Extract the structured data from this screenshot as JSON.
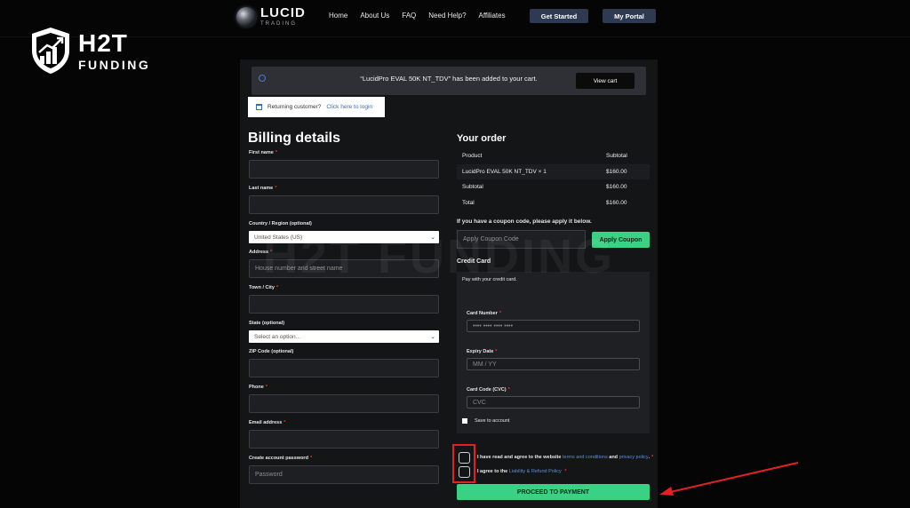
{
  "brand": {
    "main": "LUCID",
    "sub": "TRADING"
  },
  "nav": {
    "links": [
      "Home",
      "About Us",
      "FAQ",
      "Need Help?",
      "Affiliates"
    ],
    "get_started": "Get Started",
    "my_portal": "My Portal"
  },
  "h2t": {
    "main": "H2T",
    "sub": "FUNDING",
    "watermark": "H2T FUNDING"
  },
  "notice": {
    "text": "“LucidPro EVAL 50K NT_TDV” has been added to your cart.",
    "view_cart": "View cart"
  },
  "login": {
    "prefix": "Returning customer?",
    "link": "Click here to login"
  },
  "billing": {
    "title": "Billing details",
    "first_name": "First name",
    "last_name": "Last name",
    "country_label": "Country / Region (optional)",
    "country_value": "United States (US)",
    "address_label": "Address",
    "address_placeholder": "House number and street name",
    "city_label": "Town / City",
    "state_label": "State (optional)",
    "state_placeholder": "Select an option...",
    "zip_label": "ZIP Code (optional)",
    "phone_label": "Phone",
    "email_label": "Email address",
    "password_label": "Create account password",
    "password_placeholder": "Password"
  },
  "order": {
    "title": "Your order",
    "col_product": "Product",
    "col_subtotal": "Subtotal",
    "item_name": "LucidPro EVAL 50K NT_TDV  × 1",
    "item_price": "$160.00",
    "subtotal_label": "Subtotal",
    "subtotal_value": "$160.00",
    "total_label": "Total",
    "total_value": "$160.00"
  },
  "coupon": {
    "hint": "If you have a coupon code, please apply it below.",
    "placeholder": "Apply Coupon Code",
    "button": "Apply Coupon"
  },
  "credit_card": {
    "title": "Credit Card",
    "hint": "Pay with your credit card.",
    "number_label": "Card Number",
    "number_placeholder": "•••• •••• •••• ••••",
    "expiry_label": "Expiry Date",
    "expiry_placeholder": "MM / YY",
    "cvc_label": "Card Code (CVC)",
    "cvc_placeholder": "CVC",
    "save": "Save to account"
  },
  "agree": {
    "line1_prefix": "I have read and agree to the website",
    "line1_link1": "terms and conditions",
    "line1_and": "and",
    "line1_link2": "privacy policy",
    "line2_prefix": "I agree to the",
    "line2_link": "Liability & Refund Policy"
  },
  "pay_button": "PROCEED TO PAYMENT",
  "colors": {
    "accent_green": "#3ad184",
    "nav_button": "#2d3a52",
    "highlight_red": "#e22222"
  }
}
